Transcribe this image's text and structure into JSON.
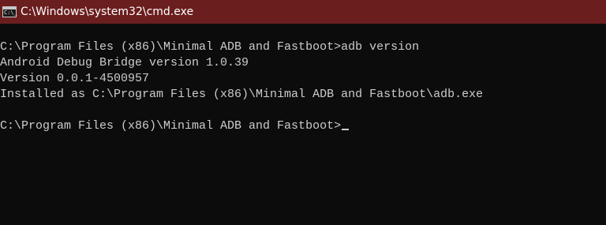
{
  "window": {
    "title": "C:\\Windows\\system32\\cmd.exe",
    "titlebar_color": "#6b1e1e",
    "icon": "command-prompt-icon",
    "icon_text": "C:\\_"
  },
  "console": {
    "background": "#0c0c0c",
    "foreground": "#cccccc",
    "lines": [
      "C:\\Program Files (x86)\\Minimal ADB and Fastboot>adb version",
      "Android Debug Bridge version 1.0.39",
      "Version 0.0.1-4500957",
      "Installed as C:\\Program Files (x86)\\Minimal ADB and Fastboot\\adb.exe",
      "",
      "C:\\Program Files (x86)\\Minimal ADB and Fastboot>"
    ]
  }
}
